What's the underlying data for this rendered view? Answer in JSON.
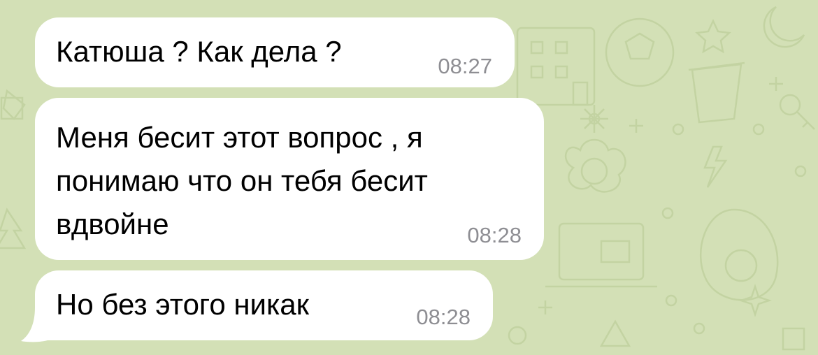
{
  "chat": {
    "messages": [
      {
        "text": "Катюша ? Как дела ?",
        "time": "08:27"
      },
      {
        "text": "Меня бесит этот вопрос , я\nпонимаю что он тебя бесит\nвдвойне",
        "time": "08:28"
      },
      {
        "text": "Но без этого никак",
        "time": "08:28"
      }
    ],
    "colors": {
      "background": "#d3e0b6",
      "bubble": "#ffffff",
      "timestamp": "#8e8e93",
      "pattern": "#c3d3a2"
    }
  }
}
